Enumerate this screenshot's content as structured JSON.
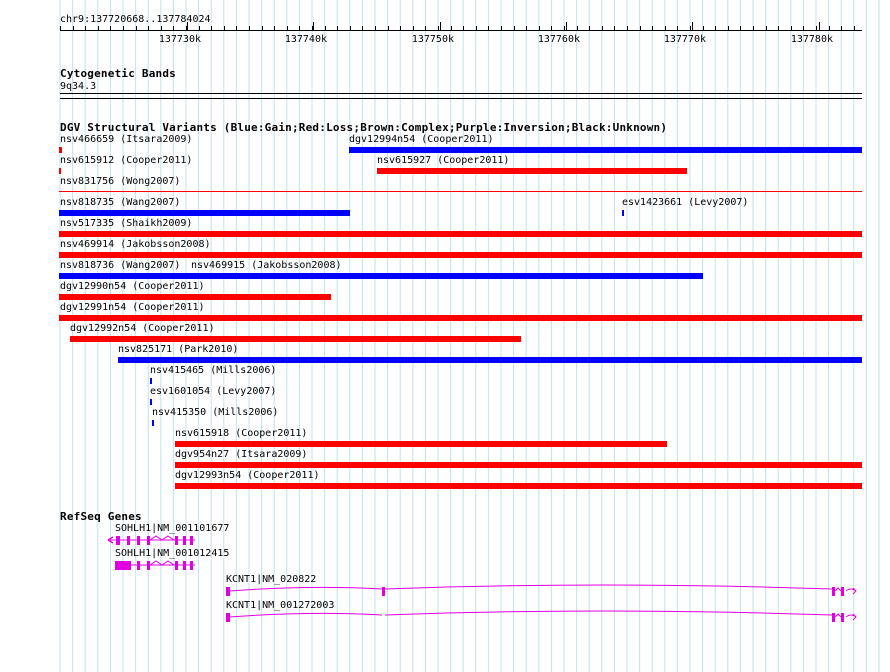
{
  "locus": "chr9:137720668..137784024",
  "ruler": {
    "ticks": [
      "137730k",
      "137740k",
      "137750k",
      "137760k",
      "137770k",
      "137780k"
    ]
  },
  "tracks": {
    "cytobands": {
      "title": "Cytogenetic Bands",
      "band": "9q34.3"
    },
    "dgv": {
      "title": "DGV Structural Variants (Blue:Gain;Red:Loss;Brown:Complex;Purple:Inversion;Black:Unknown)",
      "colors": {
        "gain": "#0000ff",
        "loss": "#ff0000"
      },
      "features": [
        {
          "label": "nsv466659 (Itsara2009)",
          "type": "loss"
        },
        {
          "label": "dgv12994n54 (Cooper2011)",
          "type": "gain"
        },
        {
          "label": "nsv615912 (Cooper2011)",
          "type": "loss"
        },
        {
          "label": "nsv615927 (Cooper2011)",
          "type": "loss"
        },
        {
          "label": "nsv831756 (Wong2007)",
          "type": "loss"
        },
        {
          "label": "nsv818735 (Wang2007)",
          "type": "gain"
        },
        {
          "label": "esv1423661 (Levy2007)",
          "type": "gain"
        },
        {
          "label": "nsv517335 (Shaikh2009)",
          "type": "loss"
        },
        {
          "label": "nsv469914 (Jakobsson2008)",
          "type": "loss"
        },
        {
          "label": "nsv818736 (Wang2007)",
          "type": "gain"
        },
        {
          "label": "nsv469915 (Jakobsson2008)",
          "type": "gain"
        },
        {
          "label": "dgv12990n54 (Cooper2011)",
          "type": "loss"
        },
        {
          "label": "dgv12991n54 (Cooper2011)",
          "type": "loss"
        },
        {
          "label": "dgv12992n54 (Cooper2011)",
          "type": "loss"
        },
        {
          "label": "nsv825171 (Park2010)",
          "type": "gain"
        },
        {
          "label": "nsv415465 (Mills2006)",
          "type": "gain"
        },
        {
          "label": "esv1601054 (Levy2007)",
          "type": "gain"
        },
        {
          "label": "nsv415350 (Mills2006)",
          "type": "gain"
        },
        {
          "label": "nsv615918 (Cooper2011)",
          "type": "loss"
        },
        {
          "label": "dgv954n27 (Itsara2009)",
          "type": "loss"
        },
        {
          "label": "dgv12993n54 (Cooper2011)",
          "type": "loss"
        }
      ]
    },
    "refseq": {
      "title": "RefSeq Genes",
      "color": "#e000e0",
      "genes": [
        {
          "label": "SOHLH1|NM_001101677"
        },
        {
          "label": "SOHLH1|NM_001012415"
        },
        {
          "label": "KCNT1|NM_020822"
        },
        {
          "label": "KCNT1|NM_001272003"
        }
      ]
    }
  }
}
